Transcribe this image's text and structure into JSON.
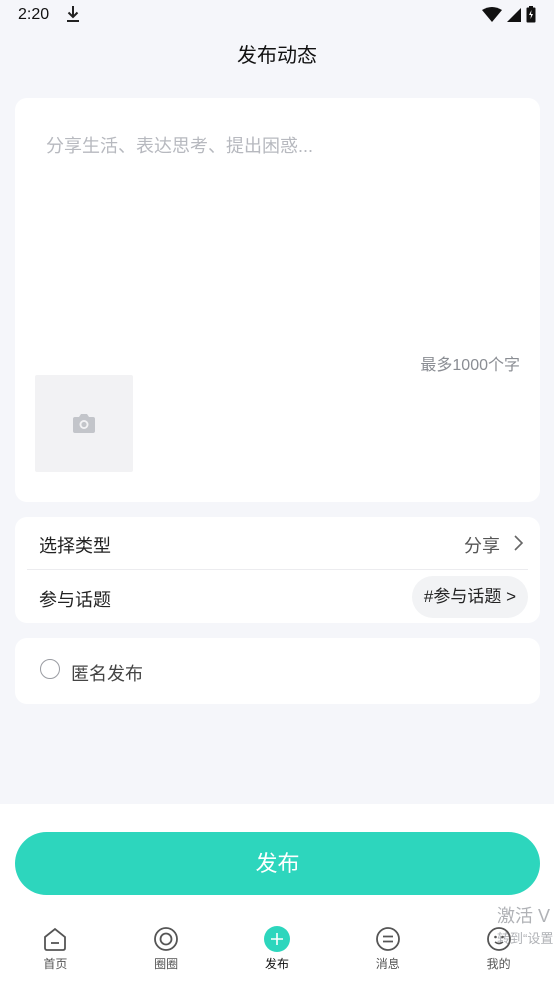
{
  "status_bar": {
    "time": "2:20"
  },
  "header": {
    "title": "发布动态"
  },
  "compose": {
    "placeholder": "分享生活、表达思考、提出困惑...",
    "char_limit": "最多1000个字"
  },
  "options": {
    "type_label": "选择类型",
    "type_value": "分享",
    "topic_label": "参与话题",
    "topic_chip": "#参与话题 >"
  },
  "anonymous": {
    "label": "匿名发布"
  },
  "publish_button": "发布",
  "watermark": {
    "line1": "激活 V",
    "line2": "转到“设置"
  },
  "tab_bar": [
    {
      "label": "首页",
      "icon": "home-icon"
    },
    {
      "label": "圈圈",
      "icon": "circle-icon"
    },
    {
      "label": "发布",
      "icon": "plus-icon"
    },
    {
      "label": "消息",
      "icon": "message-icon"
    },
    {
      "label": "我的",
      "icon": "profile-icon"
    }
  ],
  "colors": {
    "accent": "#2dd6bd",
    "background": "#f5f6fa"
  }
}
